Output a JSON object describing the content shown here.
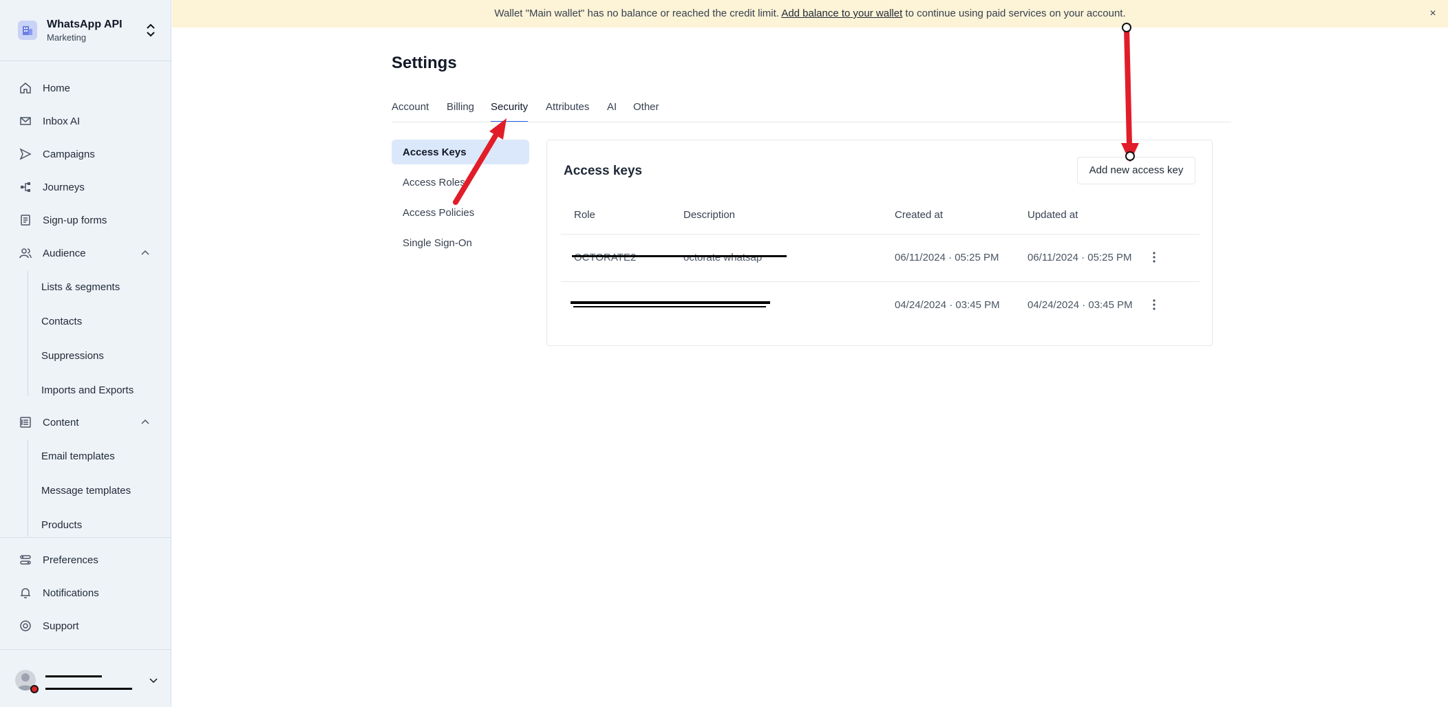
{
  "org": {
    "name": "WhatsApp API",
    "subtitle": "Marketing"
  },
  "sidebar": {
    "items": [
      {
        "label": "Home",
        "icon": "home-icon"
      },
      {
        "label": "Inbox AI",
        "icon": "mail-icon"
      },
      {
        "label": "Campaigns",
        "icon": "send-icon"
      },
      {
        "label": "Journeys",
        "icon": "flow-icon"
      },
      {
        "label": "Sign-up forms",
        "icon": "form-icon"
      },
      {
        "label": "Audience",
        "icon": "users-icon"
      },
      {
        "label": "Content",
        "icon": "content-icon"
      }
    ],
    "audience_sub": [
      "Lists & segments",
      "Contacts",
      "Suppressions",
      "Imports and Exports"
    ],
    "content_sub": [
      "Email templates",
      "Message templates",
      "Products"
    ],
    "bottom": [
      {
        "label": "Preferences",
        "icon": "preferences-icon"
      },
      {
        "label": "Notifications",
        "icon": "bell-icon"
      },
      {
        "label": "Support",
        "icon": "support-icon"
      }
    ]
  },
  "banner": {
    "text_before": "Wallet \"Main wallet\" has no balance or reached the credit limit. ",
    "link": "Add balance to your wallet",
    "text_after": " to continue using paid services on your account.",
    "close": "×"
  },
  "page": {
    "title": "Settings"
  },
  "tabs": [
    "Account",
    "Billing",
    "Security",
    "Attributes",
    "AI",
    "Other"
  ],
  "active_tab": "Security",
  "subnav": [
    "Access Keys",
    "Access Roles",
    "Access Policies",
    "Single Sign-On"
  ],
  "panel": {
    "title": "Access keys",
    "add_button": "Add new access key",
    "columns": [
      "Role",
      "Description",
      "Created at",
      "Updated at"
    ],
    "rows": [
      {
        "role": "OCTORATE2",
        "description": "octorate whatsap",
        "created": "06/11/2024 · 05:25 PM",
        "updated": "06/11/2024 · 05:25 PM"
      },
      {
        "role": "",
        "description": "",
        "created": "04/24/2024 · 03:45 PM",
        "updated": "04/24/2024 · 03:45 PM"
      }
    ]
  },
  "colors": {
    "accent": "#2563eb",
    "banner": "#fdf3d6",
    "arrow": "#e11d2a"
  }
}
